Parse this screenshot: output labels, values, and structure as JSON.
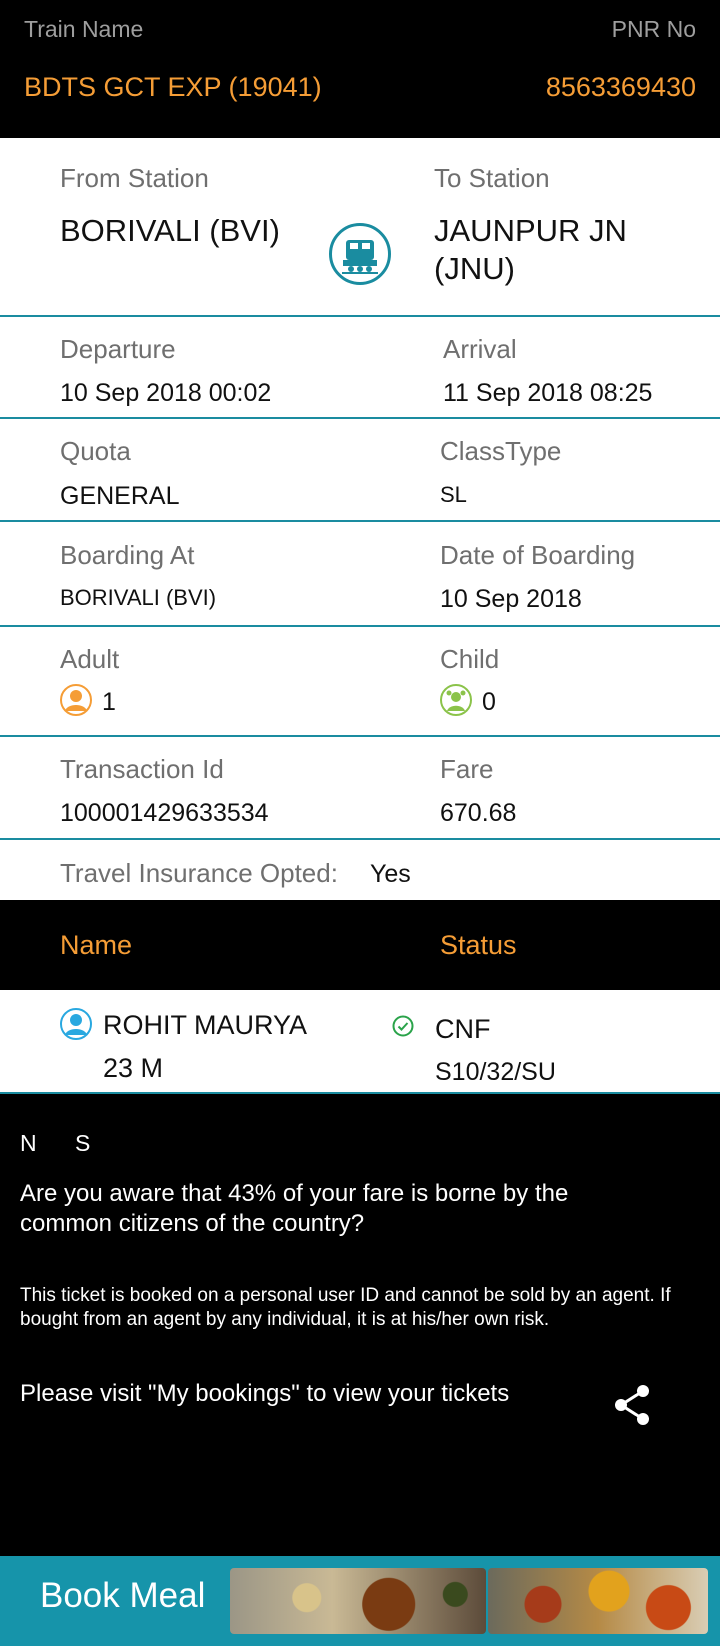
{
  "header": {
    "train_label": "Train Name",
    "pnr_label": "PNR No",
    "train_name": "BDTS GCT EXP (19041)",
    "pnr": "8563369430"
  },
  "journey": {
    "from_label": "From Station",
    "to_label": "To Station",
    "from_station": "BORIVALI (BVI)",
    "to_station_line1": "JAUNPUR JN",
    "to_station_line2": "(JNU)",
    "departure_label": "Departure",
    "arrival_label": "Arrival",
    "departure": "10 Sep 2018  00:02",
    "arrival": "11 Sep 2018  08:25",
    "quota_label": "Quota",
    "class_label": "ClassType",
    "quota": "GENERAL",
    "class": "SL",
    "boarding_label": "Boarding At",
    "boarding_date_label": "Date of Boarding",
    "boarding": "BORIVALI (BVI)",
    "boarding_date": "10 Sep 2018",
    "adult_label": "Adult",
    "child_label": "Child",
    "adult": "1",
    "child": "0",
    "txn_label": "Transaction Id",
    "fare_label": "Fare",
    "txn": "100001429633534",
    "fare": "670.68",
    "insurance_label": "Travel Insurance Opted:",
    "insurance": "Yes"
  },
  "passengers": {
    "name_header": "Name",
    "status_header": "Status",
    "rows": [
      {
        "name": "ROHIT MAURYA",
        "age_gender": "23 M",
        "status": "CNF",
        "berth": "S10/32/SU"
      }
    ]
  },
  "info": {
    "ns": "N      S",
    "awareness": "Are you aware that 43% of your fare is borne by the common citizens of the country?",
    "disclaimer": "This ticket is booked on a personal user ID and cannot be sold by an agent. If bought from an agent by any individual, it is at his/her own risk.",
    "bookings_note": "Please visit \"My bookings\" to view your tickets"
  },
  "meal": {
    "label": "Book Meal"
  },
  "colors": {
    "accent": "#f59d36",
    "teal": "#1a8ca0",
    "success": "#2aa34a"
  },
  "icons": [
    "train-icon",
    "adult-icon",
    "child-icon",
    "passenger-icon",
    "check-circle-icon",
    "share-icon"
  ]
}
